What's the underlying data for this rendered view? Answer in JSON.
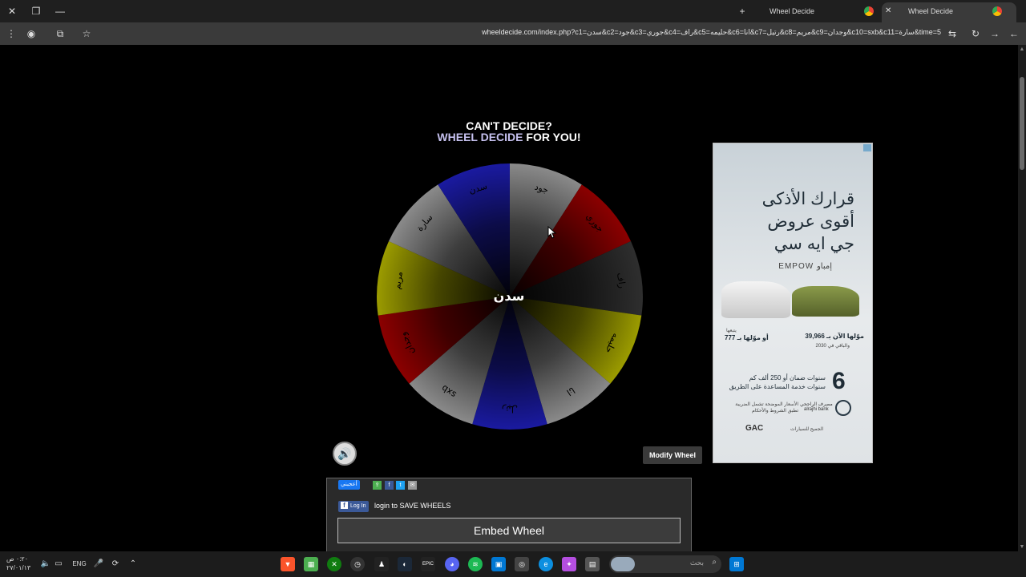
{
  "browser": {
    "tabs": [
      {
        "label": "Wheel Decide",
        "active": false
      },
      {
        "label": "Wheel Decide",
        "active": true
      }
    ],
    "url": "wheeldecide.com/index.php?c1=سدن&c2=جود&c3=جوري&c4=راف&c5=حليمه&c6=انا&c7=رتيل&c8=مريم&c9=وجدان&c10=sxb&c11=سارة&time=5"
  },
  "page": {
    "headline_line1": "CAN'T DECIDE?",
    "headline_accent": "WHEEL DECIDE",
    "headline_rest": " FOR YOU!",
    "wheel_center_label": "سدن",
    "modify_label": "Modify Wheel",
    "like_label": "أعجبني",
    "fb_login_label": "Log In",
    "login_text": "login to SAVE WHEELS",
    "embed_label": "Embed Wheel"
  },
  "wheel": {
    "segments": [
      {
        "label": "جود",
        "color": "#8a8a8a"
      },
      {
        "label": "جوري",
        "color": "#8b0000"
      },
      {
        "label": "راف",
        "color": "#2e2e2e"
      },
      {
        "label": "حليمه",
        "color": "#9b9b00"
      },
      {
        "label": "انا",
        "color": "#8a8a8a"
      },
      {
        "label": "رتيل",
        "color": "#1a1aa0"
      },
      {
        "label": "sxb",
        "color": "#8a8a8a"
      },
      {
        "label": "وجدان",
        "color": "#8b0000"
      },
      {
        "label": "مريم",
        "color": "#9b9b00"
      },
      {
        "label": "سارة",
        "color": "#8a8a8a"
      },
      {
        "label": "سدن",
        "color": "#1a1aa0"
      }
    ]
  },
  "ad": {
    "headline1": "قرارك الأذكى",
    "headline2": "أقوى عروض",
    "headline3": "جي ايه سي",
    "model": "EMPOW إمباو",
    "price1": "موّلها الآن بـ 39,966",
    "price2": "أو موّلها بـ 777",
    "small1": "والباقي في 2030",
    "small2": "يتبعها",
    "bignum": "6",
    "warranty1": "سنوات ضمان أو 250 ألف كم",
    "warranty2": "سنوات خدمة المساعدة على الطريق",
    "bank_ar": "مصرف الراجحي",
    "bank_en": "alrajhi bank",
    "note": "الأسعار الموضحة تشمل الضريبة",
    "note2": "تطبق الشروط والأحكام",
    "brand": "GAC",
    "dealer": "الجميح للسيارات"
  },
  "taskbar": {
    "clock_time": "٠:٢٠ ص",
    "clock_date": "٢٧/٠١/١٣",
    "lang": "ENG",
    "search_placeholder": "بحث"
  },
  "colors": {
    "accent_text": "#c6c1ef",
    "page_bg": "#000000",
    "panel_bg": "#2a2a2a"
  }
}
